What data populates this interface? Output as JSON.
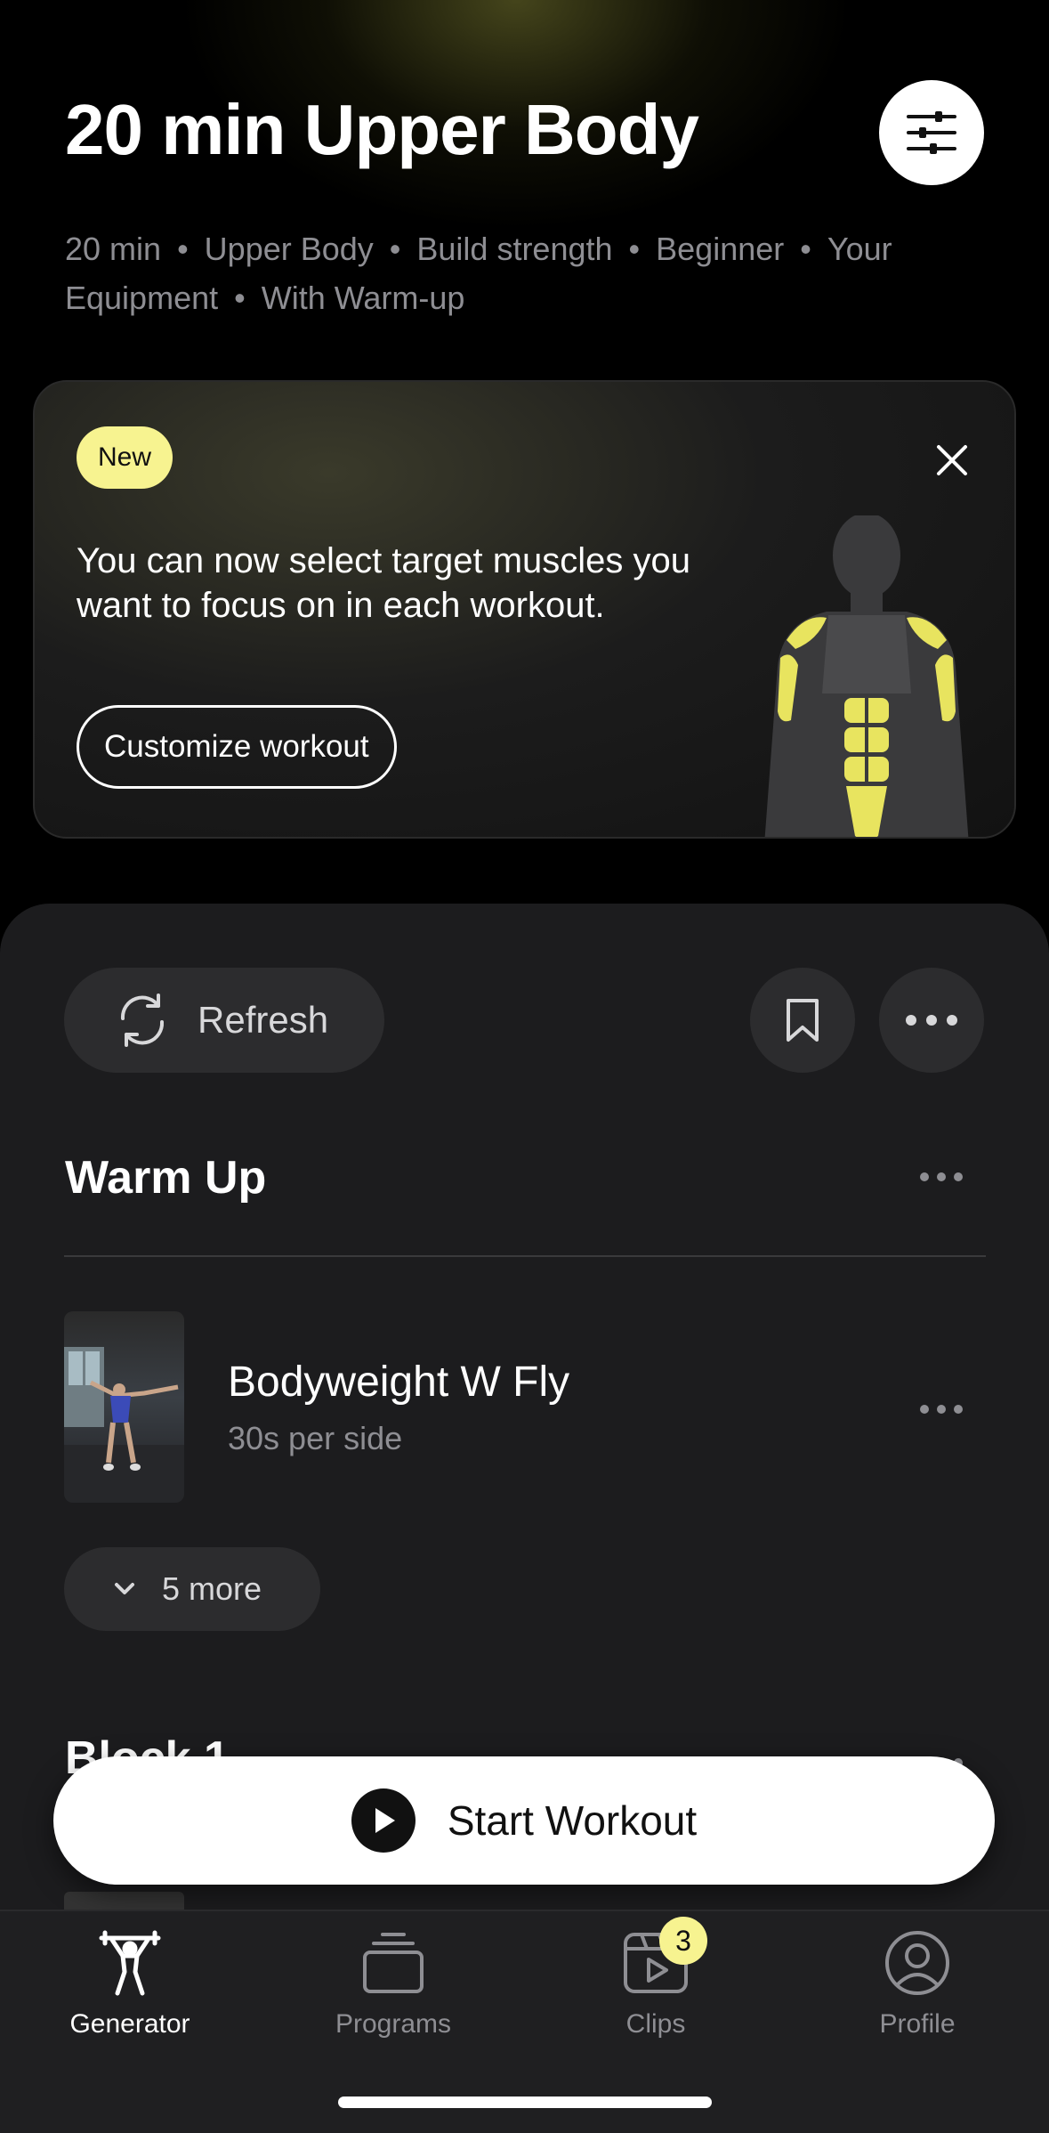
{
  "header": {
    "title": "20 min Upper Body",
    "tags": [
      "20 min",
      "Upper Body",
      "Build strength",
      "Beginner",
      "Your Equipment",
      "With Warm-up"
    ]
  },
  "promo": {
    "badge": "New",
    "text": "You can now select target muscles you want to focus on in each workout.",
    "button": "Customize workout"
  },
  "actions": {
    "refresh": "Refresh"
  },
  "sections": [
    {
      "title": "Warm Up",
      "exercise": {
        "name": "Bodyweight W Fly",
        "detail": "30s per side"
      },
      "more": "5 more"
    },
    {
      "title": "Block 1"
    }
  ],
  "start_button": "Start Workout",
  "tabs": [
    {
      "label": "Generator",
      "icon": "generator-icon",
      "active": true
    },
    {
      "label": "Programs",
      "icon": "programs-icon",
      "active": false
    },
    {
      "label": "Clips",
      "icon": "clips-icon",
      "active": false,
      "badge": "3"
    },
    {
      "label": "Profile",
      "icon": "profile-icon",
      "active": false
    }
  ],
  "colors": {
    "accent": "#f7f390",
    "background": "#000000",
    "sheet": "#1c1c1e"
  }
}
